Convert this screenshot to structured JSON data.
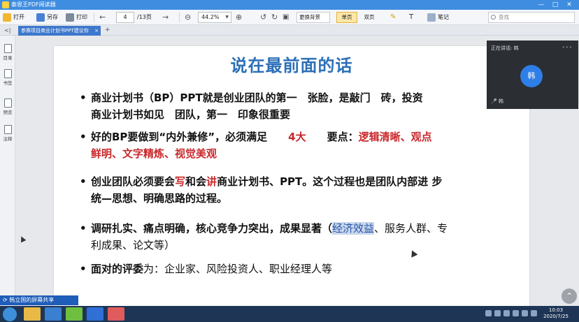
{
  "window": {
    "title": "泰恩王PDF阅读器",
    "controls": [
      "—",
      "□",
      "✕"
    ]
  },
  "toolbar": {
    "open_label": "打开",
    "save_label": "另存",
    "print_label": "打印",
    "page_current": "4",
    "page_total": "/13页",
    "zoom": "44.2%",
    "background_label": "更换背景",
    "single_label": "单页",
    "double_label": "双页",
    "notes_label": "笔记",
    "search_placeholder": "查找"
  },
  "tabs": {
    "nav": "<|",
    "active": "参赛项目商业计划书PPT建议你",
    "close": "×",
    "add": "+"
  },
  "sidebar": {
    "items": [
      "目录",
      "书签",
      "预览",
      "注释"
    ]
  },
  "slide": {
    "title": "说在最前面的话",
    "bullets": [
      {
        "line1": "商业计划书（BP）PPT就是创业团队的第一　张脸，是敲门　砖，投资",
        "line2": "商业计划书如见　团队，第一　印象很重要"
      },
      {
        "line1_a": "好的BP要做到“内外兼修”，必须满足",
        "line1_b": "4大",
        "line1_c": "要点：",
        "line1_d": "逻辑清晰、观点",
        "line2": "鲜明、文字精炼、视觉美观"
      },
      {
        "line1_a": "创业团队必须要会",
        "line1_b": "写",
        "line1_c": "和会",
        "line1_d": "讲",
        "line1_e": "商业计划书、PPT。这个过程也是团队内部进 步",
        "line2": "统—思想、明确思路的过程。"
      },
      {
        "line1_a": "调研扎实、痛点明确，核心竞争力突出，成果显著（",
        "line1_b": "经济效益",
        "line1_c": "、服务人群、专",
        "line2": "利成果、论文等）"
      },
      {
        "line1_a": "面对的评委",
        "line1_b": "为：企业家、风险投资人、职业经理人等"
      }
    ]
  },
  "video": {
    "label": "正在讲话: 韩",
    "avatar": "韩",
    "mic_name": "韩",
    "menu": "•••"
  },
  "share_bar": {
    "label": "韩立国的屏幕共享"
  },
  "clock": {
    "time": "10:03",
    "date": "2020/7/25"
  }
}
